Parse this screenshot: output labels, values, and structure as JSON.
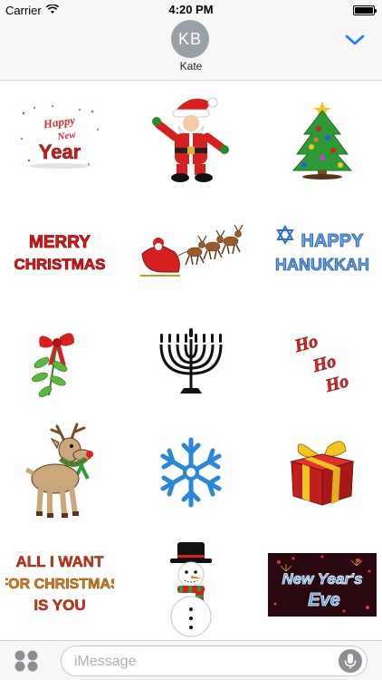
{
  "status": {
    "carrier": "Carrier",
    "time": "4:20 PM"
  },
  "header": {
    "initials": "KB",
    "name": "Kate"
  },
  "stickers": [
    {
      "text_line1": "Happy",
      "text_line2": "New",
      "text_line3": "Year"
    },
    {
      "name": "santa"
    },
    {
      "name": "christmas-tree"
    },
    {
      "text_line1": "MERRY",
      "text_line2": "CHRISTMAS"
    },
    {
      "name": "sleigh-reindeer"
    },
    {
      "text_line1": "HAPPY",
      "text_line2": "HANUKKAH"
    },
    {
      "name": "mistletoe"
    },
    {
      "name": "menorah"
    },
    {
      "text_line1": "Ho",
      "text_line2": "Ho",
      "text_line3": "Ho"
    },
    {
      "name": "reindeer"
    },
    {
      "name": "snowflake"
    },
    {
      "name": "gift-box"
    },
    {
      "text_line1": "ALL I WANT",
      "text_line2": "FOR CHRISTMAS",
      "text_line3": "IS YOU"
    },
    {
      "name": "snowman"
    },
    {
      "text_line1": "New Year's",
      "text_line2": "Eve"
    }
  ],
  "bottom": {
    "placeholder": "iMessage"
  }
}
